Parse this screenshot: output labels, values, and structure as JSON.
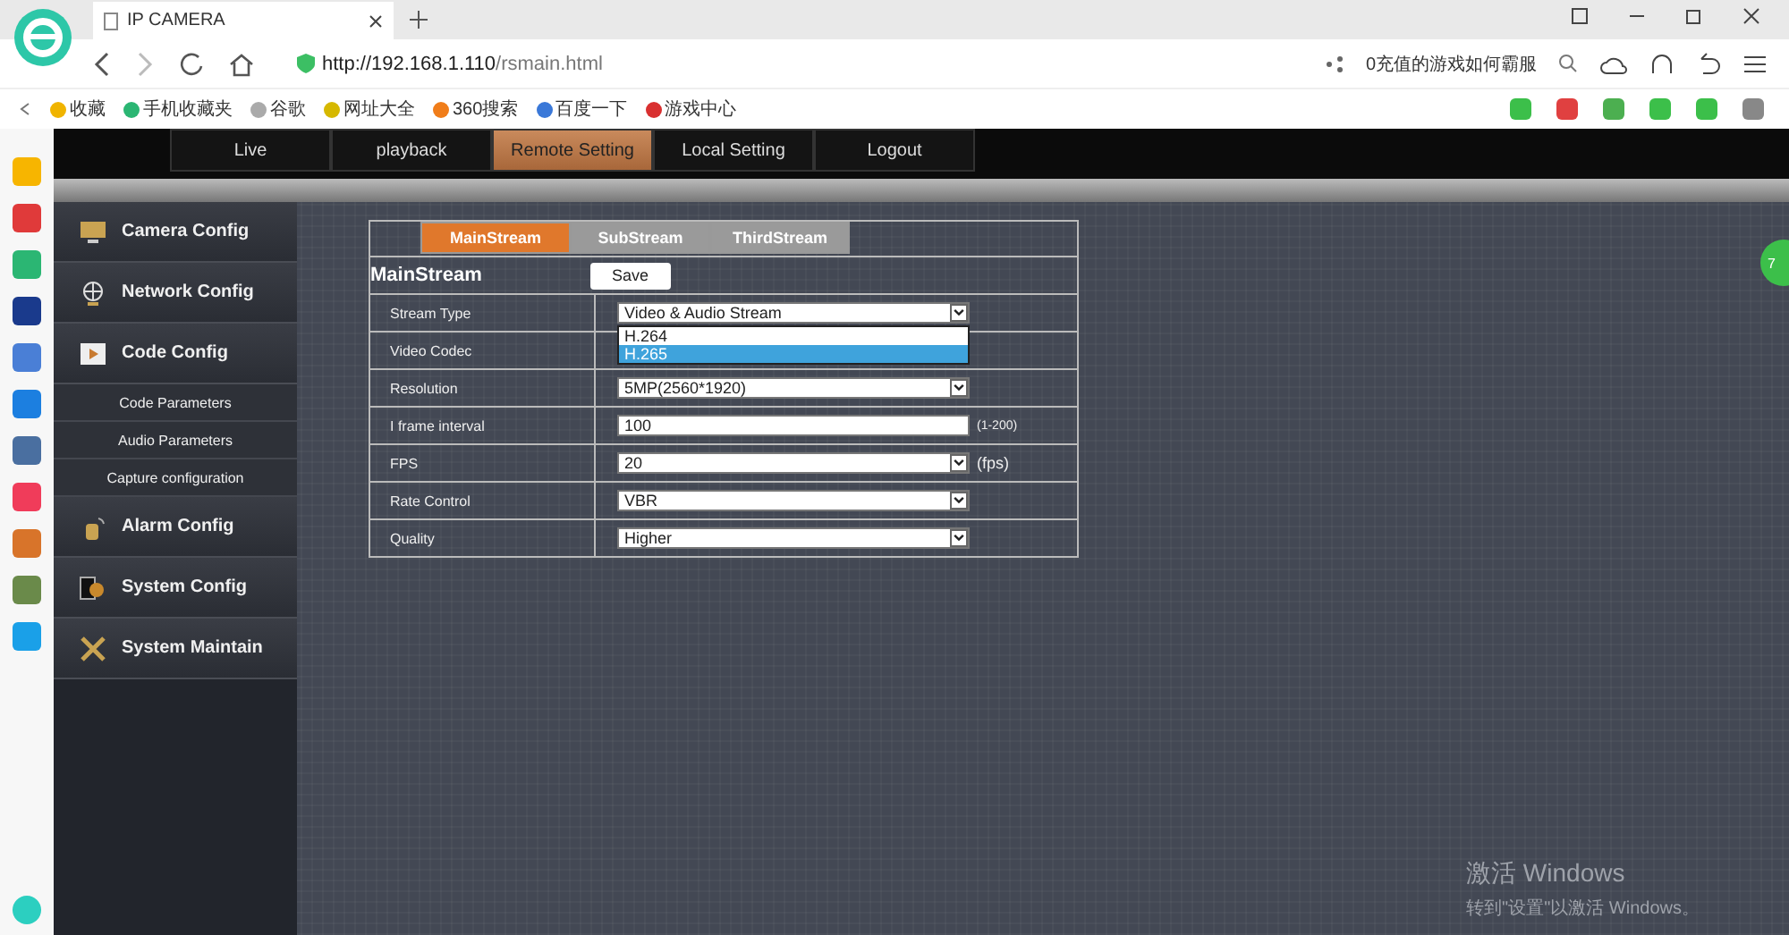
{
  "browser": {
    "tab_title": "IP CAMERA",
    "url_host": "http://192.168.1.110",
    "url_path": "/rsmain.html",
    "search_value": "0充值的游戏如何霸服",
    "bookmarks": [
      {
        "label": "收藏"
      },
      {
        "label": "手机收藏夹"
      },
      {
        "label": "谷歌"
      },
      {
        "label": "网址大全"
      },
      {
        "label": "360搜索"
      },
      {
        "label": "百度一下"
      },
      {
        "label": "游戏中心"
      }
    ],
    "badge": "7"
  },
  "nav": [
    {
      "label": "Live",
      "selected": false
    },
    {
      "label": "playback",
      "selected": false
    },
    {
      "label": "Remote Setting",
      "selected": true
    },
    {
      "label": "Local Setting",
      "selected": false
    },
    {
      "label": "Logout",
      "selected": false
    }
  ],
  "side_menu": [
    {
      "kind": "section",
      "label": "Camera Config"
    },
    {
      "kind": "section",
      "label": "Network Config"
    },
    {
      "kind": "section",
      "label": "Code Config"
    },
    {
      "kind": "sub",
      "label": "Code Parameters"
    },
    {
      "kind": "sub",
      "label": "Audio Parameters"
    },
    {
      "kind": "sub",
      "label": "Capture configuration"
    },
    {
      "kind": "section",
      "label": "Alarm Config"
    },
    {
      "kind": "section",
      "label": "System Config"
    },
    {
      "kind": "section",
      "label": "System Maintain"
    }
  ],
  "stream_tabs": [
    {
      "label": "MainStream",
      "selected": true
    },
    {
      "label": "SubStream",
      "selected": false
    },
    {
      "label": "ThirdStream",
      "selected": false
    }
  ],
  "form": {
    "title": "MainStream",
    "save": "Save",
    "rows": [
      {
        "label": "Stream Type",
        "kind": "select",
        "value": "Video & Audio Stream",
        "options": [
          {
            "label": "H.264",
            "selected": false
          },
          {
            "label": "H.265",
            "selected": true
          }
        ]
      },
      {
        "label": "Video Codec",
        "kind": "covered"
      },
      {
        "label": "Resolution",
        "kind": "select",
        "value": "5MP(2560*1920)"
      },
      {
        "label": "I frame interval",
        "kind": "input",
        "value": "100",
        "suffix": "(1-200)"
      },
      {
        "label": "FPS",
        "kind": "select",
        "value": "20",
        "suffix": "(fps)"
      },
      {
        "label": "Rate Control",
        "kind": "select",
        "value": "VBR"
      },
      {
        "label": "Quality",
        "kind": "select",
        "value": "Higher"
      }
    ]
  },
  "activation_notice": {
    "title": "激活 Windows",
    "message": "转到\"设置\"以激活 Windows。"
  }
}
